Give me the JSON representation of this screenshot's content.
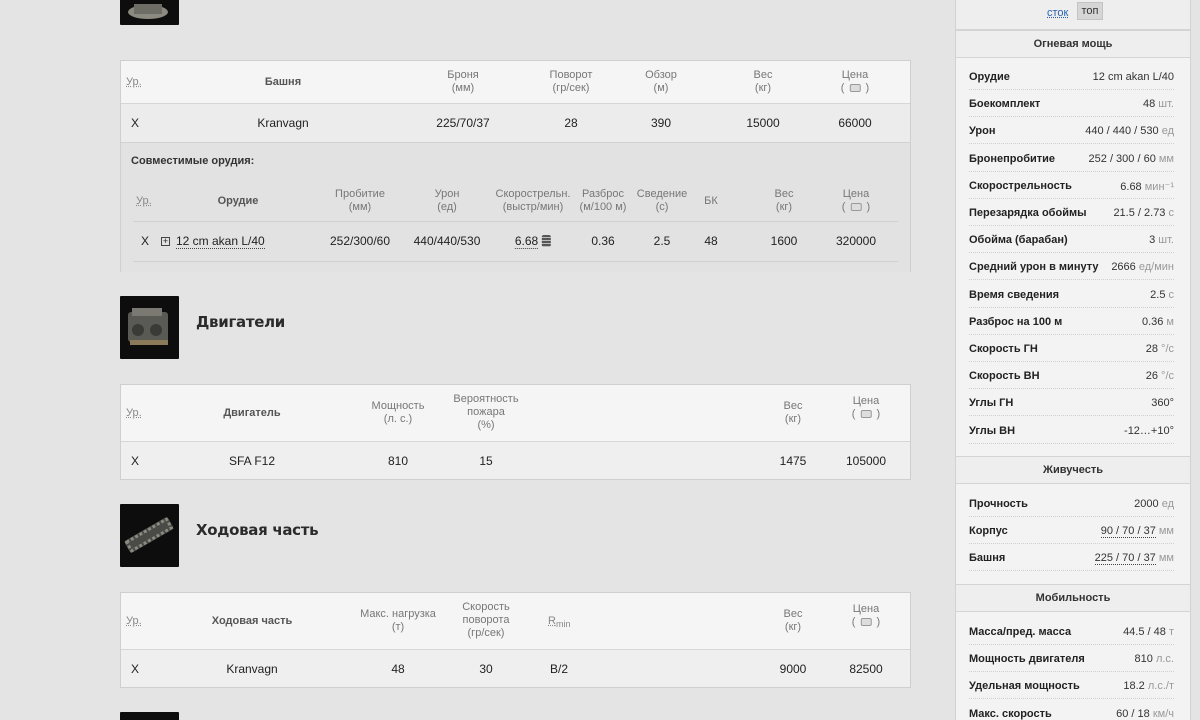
{
  "turret_table": {
    "headers": [
      "Ур.",
      "Башня",
      "Броня\n(мм)",
      "Поворот\n(гр/сек)",
      "Обзор\n(м)",
      "Вес\n(кг)",
      "Цена"
    ],
    "row": [
      "X",
      "Kranvagn",
      "225/70/37",
      "28",
      "390",
      "15000",
      "66000"
    ],
    "compatible_title": "Совместимые орудия:",
    "gun_headers": [
      "Ур.",
      "Орудие",
      "Пробитие\n(мм)",
      "Урон\n(ед)",
      "Скорострельн.\n(выстр/мин)",
      "Разброс\n(м/100 м)",
      "Сведение\n(с)",
      "БК",
      "Вес\n(кг)",
      "Цена"
    ],
    "gun_row": [
      "X",
      "12 cm akan L/40",
      "252/300/60",
      "440/440/530",
      "6.68",
      "0.36",
      "2.5",
      "48",
      "1600",
      "320000"
    ]
  },
  "engines": {
    "title": "Двигатели",
    "headers": [
      "Ур.",
      "Двигатель",
      "Мощность\n(л. с.)",
      "Вероятность\nпожара\n(%)",
      "Вес\n(кг)",
      "Цена"
    ],
    "row": [
      "X",
      "SFA F12",
      "810",
      "15",
      "1475",
      "105000"
    ]
  },
  "suspension": {
    "title": "Ходовая часть",
    "headers": [
      "Ур.",
      "Ходовая часть",
      "Макс. нагрузка\n(т)",
      "Скорость\nповорота\n(гр/сек)",
      "R",
      "min",
      "Вес\n(кг)",
      "Цена"
    ],
    "row": [
      "X",
      "Kranvagn",
      "48",
      "30",
      "B/2",
      "9000",
      "82500"
    ]
  },
  "sidebar": {
    "stock": "сток",
    "top": "топ",
    "firepower": {
      "title": "Огневая мощь",
      "rows": [
        {
          "label": "Орудие",
          "value": "12 cm akan L/40",
          "unit": ""
        },
        {
          "label": "Боекомплект",
          "value": "48",
          "unit": "шт."
        },
        {
          "label": "Урон",
          "value": "440 / 440 / 530",
          "unit": "ед"
        },
        {
          "label": "Бронепробитие",
          "value": "252 / 300 / 60",
          "unit": "мм"
        },
        {
          "label": "Скорострельность",
          "value": "6.68",
          "unit": "мин⁻¹"
        },
        {
          "label": "Перезарядка обоймы",
          "value": "21.5 / 2.73",
          "unit": "с"
        },
        {
          "label": "Обойма (барабан)",
          "value": "3",
          "unit": "шт."
        },
        {
          "label": "Средний урон в минуту",
          "value": "2666",
          "unit": "ед/мин"
        },
        {
          "label": "Время сведения",
          "value": "2.5",
          "unit": "с"
        },
        {
          "label": "Разброс на 100 м",
          "value": "0.36",
          "unit": "м"
        },
        {
          "label": "Скорость ГН",
          "value": "28",
          "unit": "°/с"
        },
        {
          "label": "Скорость ВН",
          "value": "26",
          "unit": "°/с"
        },
        {
          "label": "Углы ГН",
          "value": "360°",
          "unit": ""
        },
        {
          "label": "Углы ВН",
          "value": "-12…+10°",
          "unit": ""
        }
      ]
    },
    "survivability": {
      "title": "Живучесть",
      "rows": [
        {
          "label": "Прочность",
          "value": "2000",
          "unit": "ед"
        },
        {
          "label": "Корпус",
          "value": "90 / 70 / 37",
          "unit": "мм"
        },
        {
          "label": "Башня",
          "value": "225 / 70 / 37",
          "unit": "мм"
        }
      ]
    },
    "mobility": {
      "title": "Мобильность",
      "rows": [
        {
          "label": "Масса/пред. масса",
          "value": "44.5 / 48",
          "unit": "т"
        },
        {
          "label": "Мощность двигателя",
          "value": "810",
          "unit": "л.с."
        },
        {
          "label": "Удельная мощность",
          "value": "18.2",
          "unit": "л.с./т"
        },
        {
          "label": "Макс. скорость",
          "value": "60 / 18",
          "unit": "км/ч"
        }
      ]
    }
  }
}
